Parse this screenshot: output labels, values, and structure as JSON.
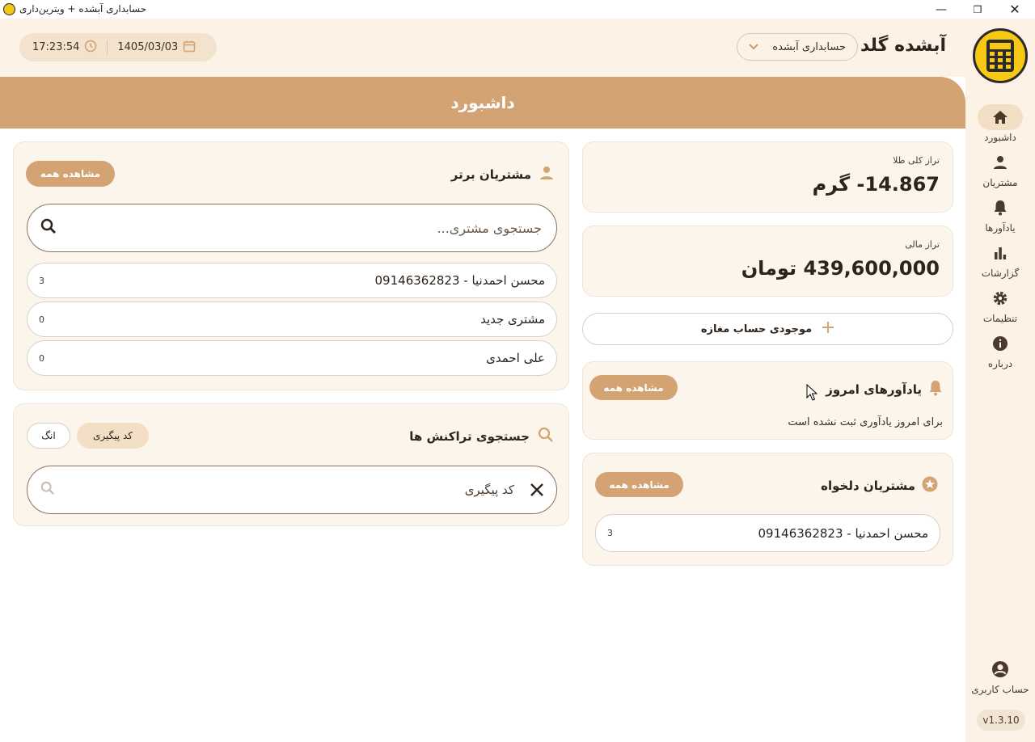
{
  "window": {
    "title": "حسابداری آبشده + ویترین‌داری",
    "controls": {
      "minimize": "—",
      "maximize": "❐",
      "close": "✕"
    }
  },
  "header": {
    "brand": "آبشده گلد",
    "account_select": "حسابداری آبشده",
    "date": "1405/03/03",
    "time": "17:23:54"
  },
  "banner": {
    "title": "داشبورد"
  },
  "sidebar": {
    "items": [
      {
        "label": "داشبورد",
        "icon": "home-icon"
      },
      {
        "label": "مشتریان",
        "icon": "person-icon"
      },
      {
        "label": "یادآورها",
        "icon": "bell-icon"
      },
      {
        "label": "گزارشات",
        "icon": "bar-chart-icon"
      },
      {
        "label": "تنظیمات",
        "icon": "gear-icon"
      },
      {
        "label": "درباره",
        "icon": "info-icon"
      }
    ],
    "account": "حساب کاربری",
    "version": "v1.3.10"
  },
  "gold_balance": {
    "label": "تراز کلی طلا",
    "value": "14.867- گرم"
  },
  "financial_balance": {
    "label": "تراز مالی",
    "value": "439,600,000 تومان"
  },
  "shop_balance_button": "موجودی حساب مغازه",
  "reminders": {
    "title": "یادآورهای امروز",
    "view_all": "مشاهده همه",
    "empty": "برای امروز یادآوری ثبت نشده است"
  },
  "favorites": {
    "title": "مشتریان دلخواه",
    "view_all": "مشاهده همه",
    "items": [
      {
        "name": "محسن احمدنیا - 09146362823",
        "count": "3"
      }
    ]
  },
  "top_customers": {
    "title": "مشتریان برتر",
    "view_all": "مشاهده همه",
    "search_placeholder": "جستجوی مشتری...",
    "items": [
      {
        "name": "محسن احمدنیا - 09146362823",
        "count": "3"
      },
      {
        "name": "مشتری جدید",
        "count": "0"
      },
      {
        "name": "علی احمدی",
        "count": "0"
      }
    ]
  },
  "tx_search": {
    "title": "جستجوی تراکنش ها",
    "chip_tracking": "کد پیگیری",
    "chip_ang": "انگ",
    "placeholder": "کد پیگیری"
  },
  "colors": {
    "accent": "#d4a373",
    "cream": "#fcf2e5",
    "dark": "#2e241b"
  }
}
